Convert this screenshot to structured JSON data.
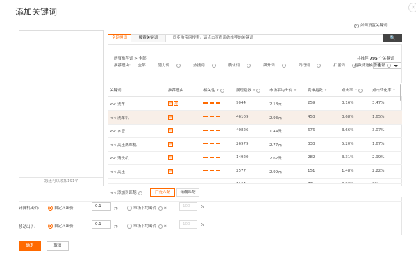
{
  "title": "添加关键词",
  "help": {
    "text": "如何设置关键词"
  },
  "left_panel": {
    "footer": "您还可以添加191个"
  },
  "tabs": [
    {
      "label": "全网搜词"
    },
    {
      "label": "搜索关键词"
    }
  ],
  "search": {
    "placeholder": "同步淘宝网搜索，请点击查看系统推荐的关键词"
  },
  "filters": {
    "crumb": "所有推荐词 >  全部",
    "reason_label": "推荐理由:",
    "reasons": [
      "全部",
      "潜力词",
      "热搜词",
      "质优词",
      "飙升词",
      "同行词",
      "扩展词",
      "触感词"
    ],
    "recommend_prefix": "共推荐",
    "recommend_count": "795",
    "recommend_suffix": "个关键词",
    "index_label": "指数筛选:",
    "index_value": "全部"
  },
  "table": {
    "headers": [
      "关键词",
      "推荐理由",
      "相关性",
      "展现指数",
      "市场平均出价",
      "竞争指数",
      "点击率",
      "点击转化率"
    ],
    "rows": [
      {
        "kw": "<< 洗车",
        "tags": [
          "热",
          "潜"
        ],
        "impr": "9044",
        "bid": "2.18元",
        "comp": "259",
        "ctr": "3.16%",
        "cvr": "3.47%",
        "hl": false
      },
      {
        "kw": "<< 洗车机",
        "tags": [
          "热"
        ],
        "impr": "46109",
        "bid": "2.93元",
        "comp": "453",
        "ctr": "3.68%",
        "cvr": "1.65%",
        "hl": true
      },
      {
        "kw": "<< 水管",
        "tags": [
          "热"
        ],
        "impr": "40826",
        "bid": "1.44元",
        "comp": "676",
        "ctr": "3.66%",
        "cvr": "3.07%",
        "hl": false
      },
      {
        "kw": "<< 高压洗车机",
        "tags": [
          "热"
        ],
        "impr": "26979",
        "bid": "2.77元",
        "comp": "333",
        "ctr": "5.20%",
        "cvr": "1.67%",
        "hl": false
      },
      {
        "kw": "<< 清洗机",
        "tags": [
          "热"
        ],
        "impr": "14920",
        "bid": "2.62元",
        "comp": "282",
        "ctr": "3.31%",
        "cvr": "2.99%",
        "hl": false
      },
      {
        "kw": "<< 高压",
        "tags": [
          "热"
        ],
        "impr": "2577",
        "bid": "2.99元",
        "comp": "151",
        "ctr": "1.48%",
        "cvr": "2.22%",
        "hl": false
      },
      {
        "kw": "<< 高压洗车",
        "tags": [],
        "impr": "1164",
        "bid": "3.43元",
        "comp": "77",
        "ctr": "3.93%",
        "cvr": "0%",
        "hl": false
      }
    ]
  },
  "add_match": {
    "label": "<< 添加到匹配",
    "options": [
      "广泛匹配",
      "精确匹配"
    ]
  },
  "pc_bid": {
    "label": "计算机出价:",
    "custom": "自定义出价:",
    "value": "0.1",
    "unit": "元",
    "market": "市场平均出价",
    "times": "×",
    "percent": "100",
    "pct_unit": "%"
  },
  "mobile_bid": {
    "label": "移动出价:",
    "custom": "自定义出价:",
    "value": "0.1",
    "unit": "元",
    "market": "市场平均出价",
    "times": "×",
    "percent": "100",
    "pct_unit": "%"
  },
  "buttons": {
    "confirm": "确定",
    "cancel": "取消"
  },
  "colors": {
    "accent": "#ff6a00"
  }
}
